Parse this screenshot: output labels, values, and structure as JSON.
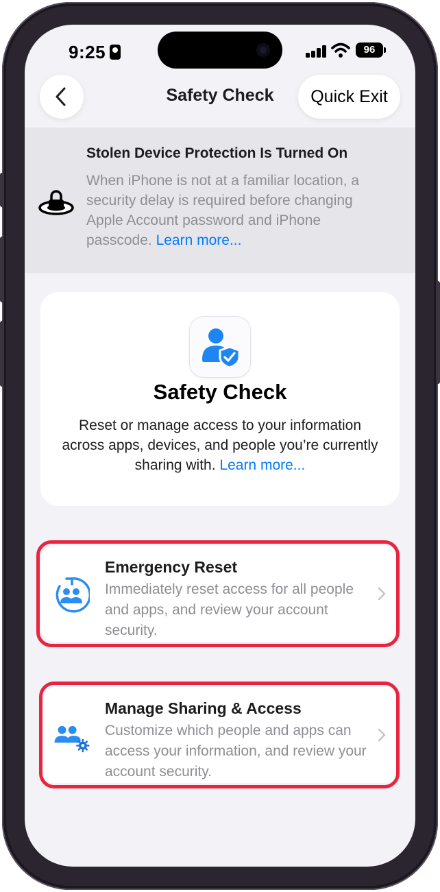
{
  "status_bar": {
    "time": "9:25",
    "battery": "96"
  },
  "nav": {
    "title": "Safety Check",
    "quick_exit_label": "Quick Exit",
    "back_icon": "chevron-left-icon"
  },
  "stolen_device_banner": {
    "title": "Stolen Device Protection Is Turned On",
    "body": "When iPhone is not at a familiar location, a security delay is required before changing Apple Account password and iPhone passcode.",
    "link": "Learn more...",
    "icon": "lock-on-disc-icon"
  },
  "safety_check_card": {
    "title": "Safety Check",
    "description": "Reset or manage access to your information across apps, devices, and people you’re currently sharing with.",
    "link": "Learn more...",
    "icon": "person-shield-icon"
  },
  "options": [
    {
      "title": "Emergency Reset",
      "body": "Immediately reset access for all people and apps, and review your account security.",
      "icon": "people-reset-icon"
    },
    {
      "title": "Manage Sharing & Access",
      "body": "Customize which people and apps can access your information, and review your account security.",
      "icon": "people-gear-icon"
    }
  ],
  "colors": {
    "accent": "#007aff",
    "highlight": "#e8253f",
    "background": "#f2f2f7",
    "banner": "#e5e5ea"
  }
}
